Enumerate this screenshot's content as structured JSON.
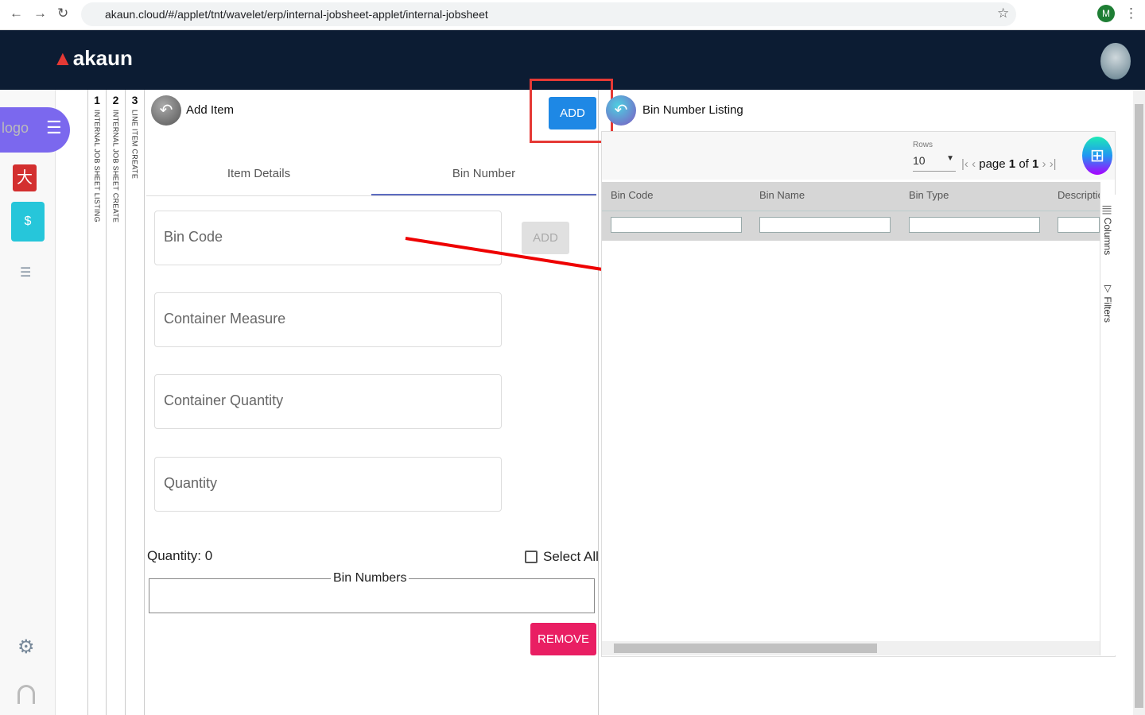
{
  "browser": {
    "url": "akaun.cloud/#/applet/tnt/wavelet/erp/internal-jobsheet-applet/internal-jobsheet"
  },
  "header": {
    "brand": "akaun"
  },
  "sidebar": {
    "logo_alt": "logo"
  },
  "steps": [
    {
      "num": "1",
      "label": "INTERNAL JOB SHEET LISTING"
    },
    {
      "num": "2",
      "label": "INTERNAL JOB SHEET CREATE"
    },
    {
      "num": "3",
      "label": "LINE ITEM CREATE"
    }
  ],
  "left": {
    "title": "Add Item",
    "add_label": "ADD",
    "tabs": [
      "Item Details",
      "Bin Number"
    ],
    "fields": {
      "bin_code": "Bin Code",
      "container_measure": "Container Measure",
      "container_quantity": "Container Quantity",
      "quantity": "Quantity"
    },
    "bin_add_label": "ADD",
    "quantity_text": "Quantity: 0",
    "select_all": "Select All",
    "bin_numbers": "Bin Numbers",
    "remove_label": "REMOVE"
  },
  "right": {
    "title": "Bin Number Listing",
    "rows_label": "Rows",
    "rows_value": "10",
    "page_word": "page",
    "page": "1",
    "of_word": "of",
    "total": "1",
    "columns": [
      "Bin Code",
      "Bin Name",
      "Bin Type",
      "Descriptio"
    ],
    "side_columns": "Columns",
    "side_filters": "Filters"
  },
  "colors": {
    "accent": "#1e88e5",
    "remove": "#e91e63",
    "header": "#0c1c33",
    "highlight": "#e53935"
  }
}
